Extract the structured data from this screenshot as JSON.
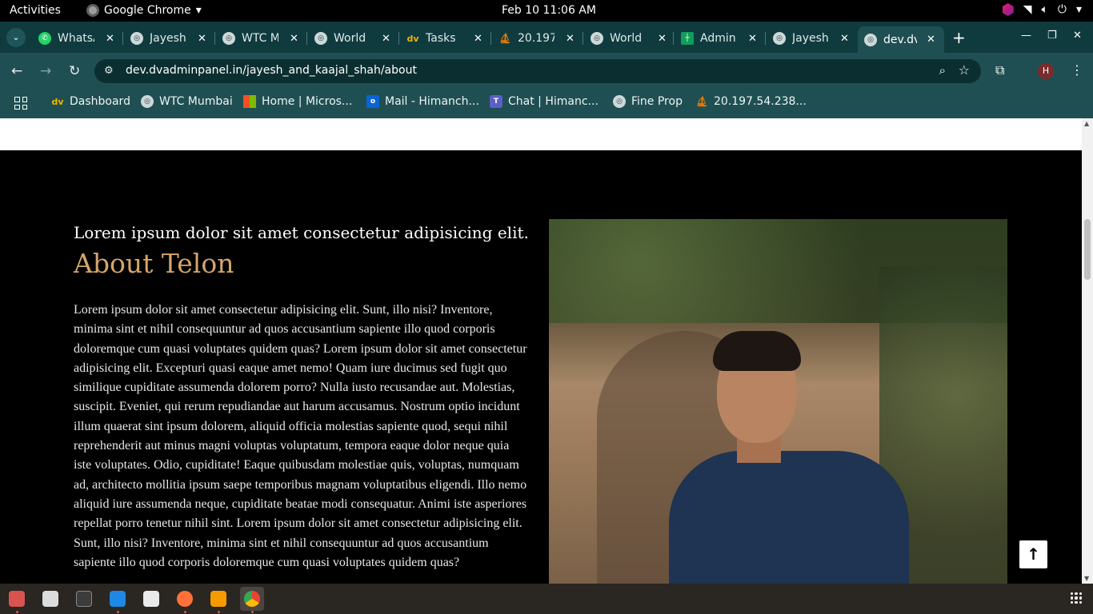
{
  "system_bar": {
    "activities": "Activities",
    "app_name": "Google Chrome",
    "datetime": "Feb 10  11:06 AM"
  },
  "tabs": [
    {
      "label": "WhatsApp",
      "favicon": "whatsapp-icon"
    },
    {
      "label": "Jayesh",
      "favicon": "globe-icon"
    },
    {
      "label": "WTC Mumbai",
      "favicon": "globe-icon"
    },
    {
      "label": "World",
      "favicon": "globe-icon"
    },
    {
      "label": "Tasks",
      "favicon": "dv-icon"
    },
    {
      "label": "20.197",
      "favicon": "ship-icon"
    },
    {
      "label": "World",
      "favicon": "globe-icon"
    },
    {
      "label": "Admin",
      "favicon": "sheets-icon"
    },
    {
      "label": "Jayesh",
      "favicon": "globe-icon"
    },
    {
      "label": "dev.dvadminpanel",
      "favicon": "globe-icon",
      "active": true
    }
  ],
  "address_bar": {
    "url": "dev.dvadminpanel.in/jayesh_and_kaajal_shah/about"
  },
  "profile": {
    "initial": "H"
  },
  "bookmarks": [
    {
      "label": "Dashboard",
      "icon": "dv-icon"
    },
    {
      "label": "WTC Mumbai",
      "icon": "globe-icon"
    },
    {
      "label": "Home | Micros...",
      "icon": "microsoft-icon"
    },
    {
      "label": "Mail - Himanch...",
      "icon": "outlook-icon"
    },
    {
      "label": "Chat | Himanc...",
      "icon": "teams-icon"
    },
    {
      "label": "Fine Prop",
      "icon": "globe-icon"
    },
    {
      "label": "20.197.54.238...",
      "icon": "ship-icon"
    }
  ],
  "page": {
    "subtitle": "Lorem ipsum dolor sit amet consectetur adipisicing elit.",
    "heading": "About Telon",
    "body": "Lorem ipsum dolor sit amet consectetur adipisicing elit. Sunt, illo nisi? Inventore, minima sint et nihil consequuntur ad quos accusantium sapiente illo quod corporis doloremque cum quasi voluptates quidem quas? Lorem ipsum dolor sit amet consectetur adipisicing elit. Excepturi quasi eaque amet nemo! Quam iure ducimus sed fugit quo similique cupiditate assumenda dolorem porro? Nulla iusto recusandae aut. Molestias, suscipit. Eveniet, qui rerum repudiandae aut harum accusamus. Nostrum optio incidunt illum quaerat sint ipsum dolorem, aliquid officia molestias sapiente quod, sequi nihil reprehenderit aut minus magni voluptas voluptatum, tempora eaque dolor neque quia iste voluptates. Odio, cupiditate! Eaque quibusdam molestiae quis, voluptas, numquam ad, architecto mollitia ipsum saepe temporibus magnam voluptatibus eligendi. Illo nemo aliquid iure assumenda neque, cupiditate beatae modi consequatur. Animi iste asperiores repellat porro tenetur nihil sint. Lorem ipsum dolor sit amet consectetur adipisicing elit. Sunt, illo nisi? Inventore, minima sint et nihil consequuntur ad quos accusantium sapiente illo quod corporis doloremque cum quasi voluptates quidem quas?",
    "heading_color": "#d4a56a"
  },
  "dock": {
    "apps": [
      "files-icon",
      "folder-icon",
      "terminal-icon",
      "vscode-icon",
      "text-editor-icon",
      "firefox-icon",
      "sublime-icon",
      "chrome-icon"
    ]
  }
}
